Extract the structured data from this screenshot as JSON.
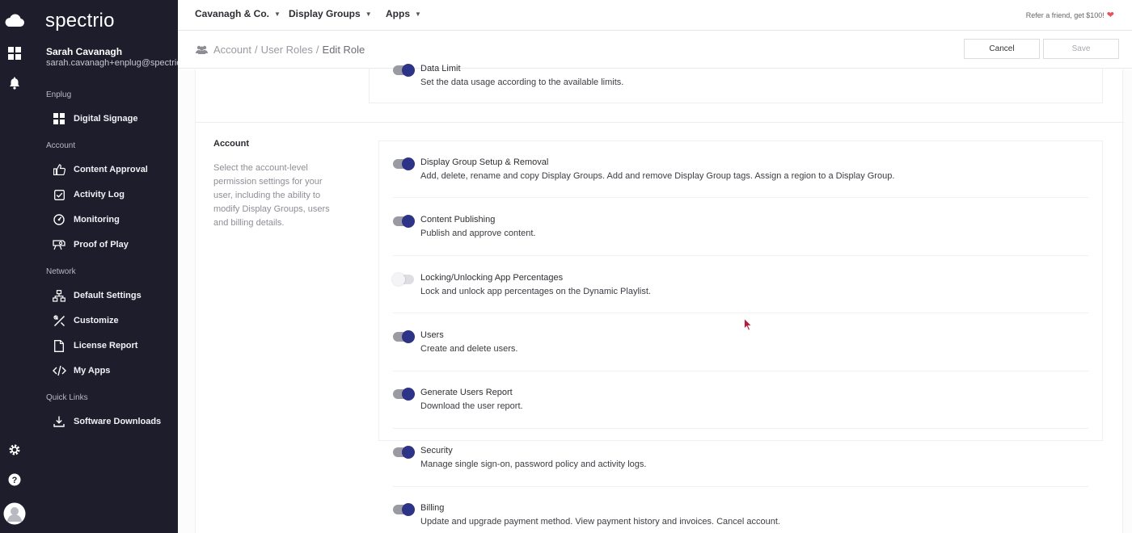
{
  "sidebar": {
    "brand": "spectrio",
    "user_name": "Sarah Cavanagh",
    "user_email": "sarah.cavanagh+enplug@spectrio.com",
    "sections": [
      {
        "label": "Enplug",
        "items": [
          {
            "label": "Digital Signage",
            "icon": "grid-icon"
          }
        ]
      },
      {
        "label": "Account",
        "items": [
          {
            "label": "Content Approval",
            "icon": "thumbs-up-icon"
          },
          {
            "label": "Activity Log",
            "icon": "checkbox-icon"
          },
          {
            "label": "Monitoring",
            "icon": "gauge-icon"
          },
          {
            "label": "Proof of Play",
            "icon": "projector-icon"
          }
        ]
      },
      {
        "label": "Network",
        "items": [
          {
            "label": "Default Settings",
            "icon": "network-icon"
          },
          {
            "label": "Customize",
            "icon": "tools-icon"
          },
          {
            "label": "License Report",
            "icon": "document-icon"
          },
          {
            "label": "My Apps",
            "icon": "code-icon"
          }
        ]
      },
      {
        "label": "Quick Links",
        "items": [
          {
            "label": "Software Downloads",
            "icon": "download-icon"
          }
        ]
      }
    ]
  },
  "topbar": {
    "menus": [
      "Cavanagh & Co.",
      "Display Groups",
      "Apps"
    ],
    "refer_text": "Refer a friend, get $100!"
  },
  "breadcrumb": {
    "items": [
      "Account",
      "User Roles",
      "Edit Role"
    ],
    "separator": "/"
  },
  "actions": {
    "cancel": "Cancel",
    "save": "Save"
  },
  "data_limit": {
    "title": "Data Limit",
    "description": "Set the data usage according to the available limits.",
    "enabled": true
  },
  "account_section": {
    "title": "Account",
    "description": "Select the account-level permission settings for your user, including the ability to modify Display Groups, users and billing details.",
    "permissions": [
      {
        "title": "Display Group Setup & Removal",
        "description": "Add, delete, rename and copy Display Groups. Add and remove Display Group tags. Assign a region to a Display Group.",
        "enabled": true
      },
      {
        "title": "Content Publishing",
        "description": "Publish and approve content.",
        "enabled": true
      },
      {
        "title": "Locking/Unlocking App Percentages",
        "description": "Lock and unlock app percentages on the Dynamic Playlist.",
        "enabled": false
      },
      {
        "title": "Users",
        "description": "Create and delete users.",
        "enabled": true
      },
      {
        "title": "Generate Users Report",
        "description": "Download the user report.",
        "enabled": true
      },
      {
        "title": "Security",
        "description": "Manage single sign-on, password policy and activity logs.",
        "enabled": true
      },
      {
        "title": "Billing",
        "description": "Update and upgrade payment method. View payment history and invoices. Cancel account.",
        "enabled": true
      }
    ]
  },
  "colors": {
    "sidebar_bg": "#1e1d2c",
    "toggle_knob": "#2d3386",
    "heart": "#e6525d"
  }
}
